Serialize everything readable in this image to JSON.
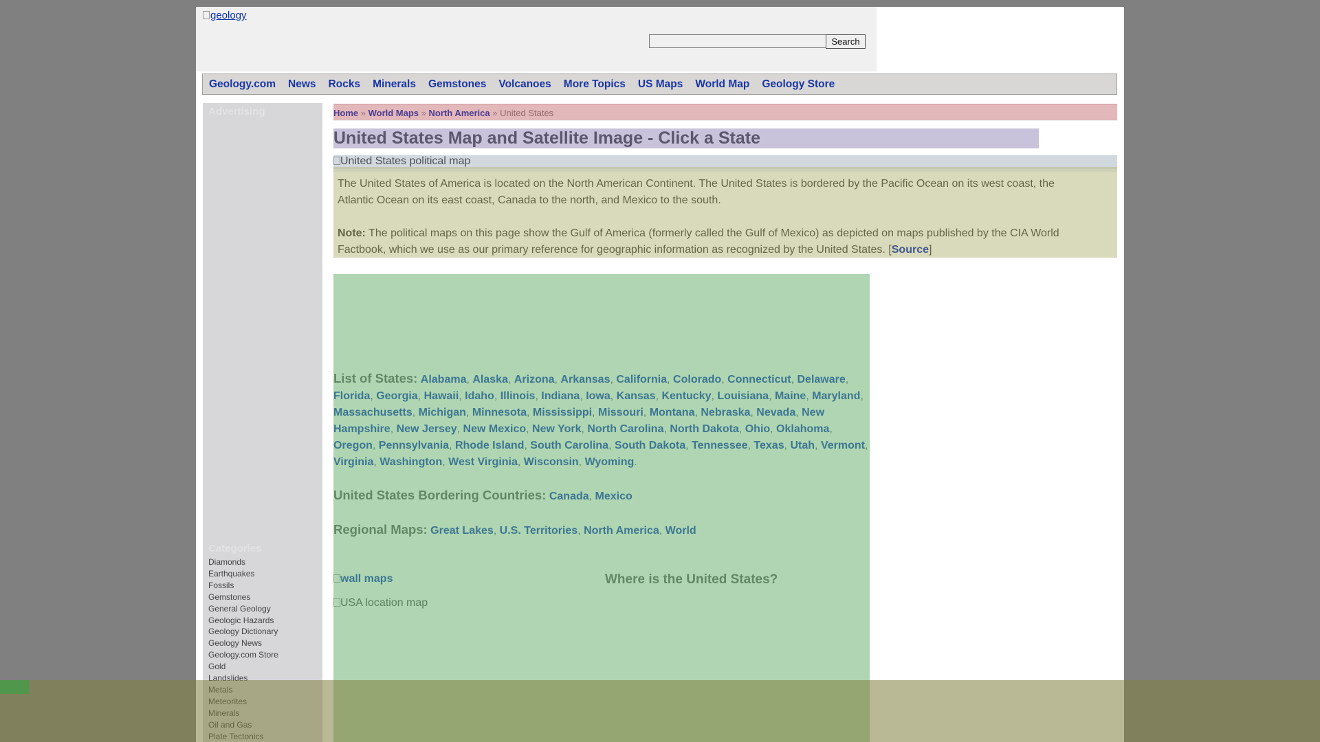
{
  "header": {
    "logo_alt": "geology",
    "search_placeholder": "",
    "search_button": "Search"
  },
  "nav": {
    "items": [
      "Geology.com",
      "News",
      "Rocks",
      "Minerals",
      "Gemstones",
      "Volcanoes",
      "More Topics",
      "US Maps",
      "World Map",
      "Geology Store"
    ]
  },
  "sidebar": {
    "advertising": "Advertising",
    "categories_heading": "Categories",
    "categories": [
      "Diamonds",
      "Earthquakes",
      "Fossils",
      "Gemstones",
      "General Geology",
      "Geologic Hazards",
      "Geology Dictionary",
      "Geology News",
      "Geology.com Store",
      "Gold",
      "Landslides",
      "Metals",
      "Meteorites",
      "Minerals",
      "Oil and Gas",
      "Plate Tectonics"
    ]
  },
  "breadcrumb": {
    "home": "Home",
    "sep": "»",
    "world_maps": "World Maps",
    "north_america": "North America",
    "current": "United States"
  },
  "main": {
    "title": "United States Map and Satellite Image - Click a State",
    "political_map_alt": "United States political map",
    "intro": "The United States of America is located on the North American Continent. The United States is bordered by the Pacific Ocean on its west coast, the Atlantic Ocean on its east coast, Canada to the north, and Mexico to the south.",
    "note_label": "Note:",
    "note_text": "The political maps on this page show the Gulf of America (formerly called the Gulf of Mexico) as depicted on maps published by the CIA World Factbook, which we use as our primary reference for geographic information as recognized by the United States. [",
    "source_link": "Source",
    "note_end": "]",
    "states_label": "List of States:",
    "states": [
      "Alabama",
      "Alaska",
      "Arizona",
      "Arkansas",
      "California",
      "Colorado",
      "Connecticut",
      "Delaware",
      "Florida",
      "Georgia",
      "Hawaii",
      "Idaho",
      "Illinois",
      "Indiana",
      "Iowa",
      "Kansas",
      "Kentucky",
      "Louisiana",
      "Maine",
      "Maryland",
      "Massachusetts",
      "Michigan",
      "Minnesota",
      "Mississippi",
      "Missouri",
      "Montana",
      "Nebraska",
      "Nevada",
      "New Hampshire",
      "New Jersey",
      "New Mexico",
      "New York",
      "North Carolina",
      "North Dakota",
      "Ohio",
      "Oklahoma",
      "Oregon",
      "Pennsylvania",
      "Rhode Island",
      "South Carolina",
      "South Dakota",
      "Tennessee",
      "Texas",
      "Utah",
      "Vermont",
      "Virginia",
      "Washington",
      "West Virginia",
      "Wisconsin",
      "Wyoming"
    ],
    "bordering_label": "United States Bordering Countries:",
    "bordering": [
      "Canada",
      "Mexico"
    ],
    "regional_label": "Regional Maps:",
    "regional": [
      "Great Lakes",
      "U.S. Territories",
      "North America",
      "World"
    ],
    "wall_maps_alt": "wall maps",
    "where_heading": "Where is the United States?",
    "usa_location_alt": "USA location map"
  },
  "colors": {
    "link": "#0b32b0",
    "background": "#808080"
  }
}
